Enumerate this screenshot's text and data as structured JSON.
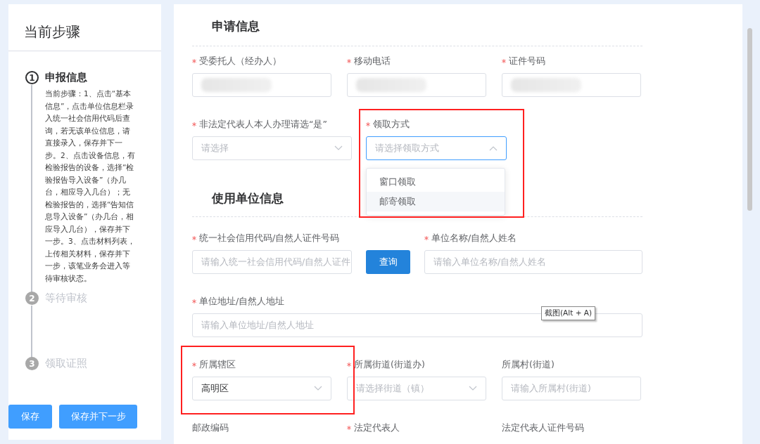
{
  "sidebar": {
    "title": "当前步骤",
    "steps": [
      {
        "number": "1",
        "title": "申报信息",
        "active": true,
        "description": "当前步骤：1、点击“基本信息”，点击单位信息栏录入统一社会信用代码后查询，若无该单位信息，请直接录入，保存并下一步。2、点击设备信息，有检验报告的设备，选择“检验报告导入设备”（办几台，相应导入几台）；无检验报告的，选择“告知信息导入设备”（办几台，相应导入几台），保存并下一步。3、点击材料列表，上传相关材料，保存并下一步，该笔业务会进入等待审核状态。"
      },
      {
        "number": "2",
        "title": "等待审核",
        "active": false
      },
      {
        "number": "3",
        "title": "领取证照",
        "active": false
      }
    ],
    "buttons": [
      "保存",
      "保存并下一步"
    ]
  },
  "sections": [
    {
      "title": "申请信息",
      "rows": [
        [
          {
            "kind": "input",
            "label": "受委托人（经办人）",
            "required": true,
            "redacted": true,
            "highlighted": false
          },
          {
            "kind": "input",
            "label": "移动电话",
            "required": true,
            "redacted": true,
            "highlighted": false
          },
          {
            "kind": "input",
            "label": "证件号码",
            "required": true,
            "redacted": true,
            "highlighted": false
          }
        ],
        [
          {
            "kind": "select",
            "label": "非法定代表人本人办理请选“是”",
            "required": true,
            "placeholder": "请选择",
            "open": false,
            "highlighted": false
          },
          {
            "kind": "select",
            "label": "领取方式",
            "required": true,
            "placeholder": "请选择领取方式",
            "open": true,
            "highlighted": true,
            "options": [
              {
                "label": "窗口领取",
                "highlighted": false
              },
              {
                "label": "邮寄领取",
                "highlighted": true
              }
            ]
          }
        ]
      ]
    },
    {
      "title": "使用单位信息",
      "rows": [
        [
          {
            "kind": "input",
            "label": "统一社会信用代码/自然人证件号码",
            "required": true,
            "placeholder": "请输入统一社会信用代码/自然人证件",
            "highlighted": false
          },
          {
            "kind": "button",
            "label": "查询"
          },
          {
            "kind": "input",
            "label": "单位名称/自然人姓名",
            "required": true,
            "placeholder": "请输入单位名称/自然人姓名",
            "highlighted": false
          }
        ],
        [
          {
            "kind": "input",
            "label": "单位地址/自然人地址",
            "required": true,
            "placeholder": "请输入单位地址/自然人地址",
            "highlighted": false
          }
        ],
        [
          {
            "kind": "select",
            "label": "所属辖区",
            "required": true,
            "value": "高明区",
            "open": false,
            "highlighted": true
          },
          {
            "kind": "select",
            "label": "所属街道(街道办)",
            "required": true,
            "placeholder": "请选择街道（镇）",
            "open": false,
            "highlighted": false
          },
          {
            "kind": "input",
            "label": "所属村(街道)",
            "required": false,
            "placeholder": "请输入所属村(街道)",
            "highlighted": false
          }
        ],
        [
          {
            "kind": "label",
            "label": "邮政编码",
            "required": false
          },
          {
            "kind": "label",
            "label": "法定代表人",
            "required": true
          },
          {
            "kind": "label",
            "label": "法定代表人证件号码",
            "required": false
          }
        ]
      ]
    }
  ],
  "tooltip": "截图(Alt + A)"
}
